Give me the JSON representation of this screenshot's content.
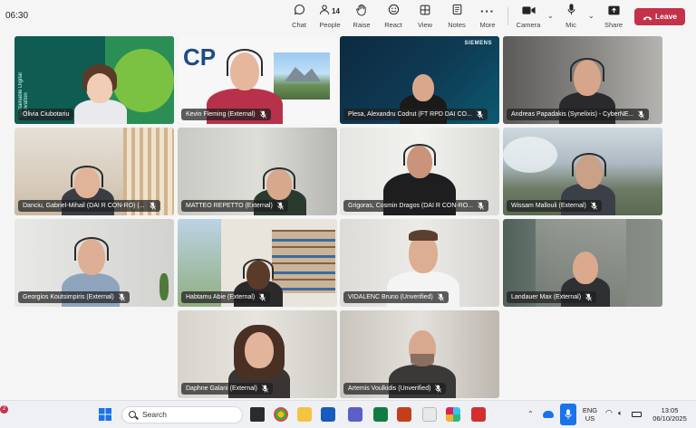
{
  "topbar": {
    "time": "06:30",
    "people_count": "14",
    "buttons": {
      "chat": "Chat",
      "people": "People",
      "raise": "Raise",
      "react": "React",
      "view": "View",
      "notes": "Notes",
      "more": "More",
      "camera": "Camera",
      "mic": "Mic",
      "share": "Share",
      "leave": "Leave"
    }
  },
  "tiles": [
    {
      "name": "Olivia Ciubotariu"
    },
    {
      "name": "Kevin Fleming (External)"
    },
    {
      "name": "Plesa, Alexandru Codrut (FT RPD DAI CO..."
    },
    {
      "name": "Andreas Papadakis (Synelixis) - CyberNE..."
    },
    {
      "name": "Danciu, Gabriel-Mihail (DAI R CON-RO) (..."
    },
    {
      "name": "MATTEO REPETTO (External)"
    },
    {
      "name": "Grigoras, Cosmin Dragos (DAI R CON-RO..."
    },
    {
      "name": "Wissam Mallouli (External)"
    },
    {
      "name": "Georgios Koutsimpiris (External)"
    },
    {
      "name": "Habtamu Abie (External)"
    },
    {
      "name": "VIDALENC Bruno (Unverified)"
    },
    {
      "name": "Landauer Max (External)"
    },
    {
      "name": "Daphne Galani (External)"
    },
    {
      "name": "Artemis Voulkidis (Unverified)"
    }
  ],
  "tile_text": {
    "background_slogan": "Sustainable Digital Innovation",
    "cp_logo": "CP",
    "siemens": "SIEMENS"
  },
  "taskbar": {
    "notification_count": "2",
    "search_placeholder": "Search",
    "language": "ENG",
    "region": "US",
    "clock_time": "13:05",
    "clock_date": "06/10/2025"
  },
  "colors": {
    "leave": "#c4314b",
    "active_speaker_outline": "#7f85f5"
  }
}
